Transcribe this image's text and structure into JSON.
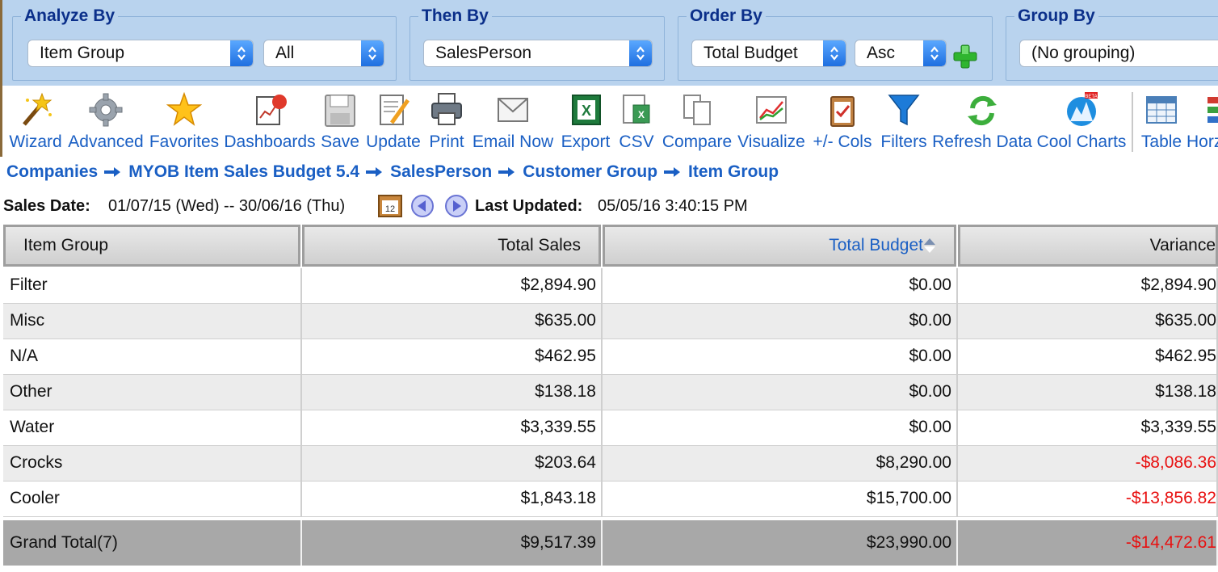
{
  "selectors": {
    "analyze_by": {
      "legend": "Analyze By",
      "field": "Item Group",
      "filter": "All"
    },
    "then_by": {
      "legend": "Then By",
      "field": "SalesPerson"
    },
    "order_by": {
      "legend": "Order By",
      "field": "Total Budget",
      "direction": "Asc"
    },
    "group_by": {
      "legend": "Group By",
      "field": "(No grouping)"
    }
  },
  "toolbar": [
    {
      "label": "Wizard",
      "icon": "wizard-wand-icon"
    },
    {
      "label": "Advanced",
      "icon": "gear-icon"
    },
    {
      "label": "Favorites",
      "icon": "star-icon"
    },
    {
      "label": "Dashboards",
      "icon": "dashboard-icon"
    },
    {
      "label": "Save",
      "icon": "floppy-disk-icon"
    },
    {
      "label": "Update",
      "icon": "edit-document-icon"
    },
    {
      "label": "Print",
      "icon": "printer-icon"
    },
    {
      "label": "Email Now",
      "icon": "email-icon"
    },
    {
      "label": "Export",
      "icon": "excel-icon"
    },
    {
      "label": "CSV",
      "icon": "csv-icon"
    },
    {
      "label": "Compare",
      "icon": "compare-icon"
    },
    {
      "label": "Visualize",
      "icon": "line-chart-icon"
    },
    {
      "label": "+/- Cols",
      "icon": "clipboard-check-icon"
    },
    {
      "label": "Filters",
      "icon": "funnel-icon"
    },
    {
      "label": "Refresh Data",
      "icon": "refresh-icon"
    },
    {
      "label": "Cool Charts",
      "icon": "cool-charts-icon",
      "badge": "BETA"
    },
    {
      "label": "Table",
      "icon": "table-icon"
    },
    {
      "label": "Horz",
      "icon": "horizontal-bars-icon"
    }
  ],
  "breadcrumb": [
    "Companies",
    "MYOB Item Sales Budget 5.4",
    "SalesPerson",
    "Customer Group",
    "Item Group"
  ],
  "dateline": {
    "sales_date_label": "Sales Date:",
    "sales_date_value": "01/07/15 (Wed) -- 30/06/16 (Thu)",
    "calendar_day": "12",
    "last_updated_label": "Last Updated:",
    "last_updated_value": "05/05/16 3:40:15 PM"
  },
  "table": {
    "columns": [
      "Item Group",
      "Total Sales",
      "Total Budget",
      "Variance"
    ],
    "sorted_column": "Total Budget",
    "rows": [
      {
        "group": "Filter",
        "sales": "$2,894.90",
        "budget": "$0.00",
        "variance": "$2,894.90",
        "negative": false
      },
      {
        "group": "Misc",
        "sales": "$635.00",
        "budget": "$0.00",
        "variance": "$635.00",
        "negative": false
      },
      {
        "group": "N/A",
        "sales": "$462.95",
        "budget": "$0.00",
        "variance": "$462.95",
        "negative": false
      },
      {
        "group": "Other",
        "sales": "$138.18",
        "budget": "$0.00",
        "variance": "$138.18",
        "negative": false
      },
      {
        "group": "Water",
        "sales": "$3,339.55",
        "budget": "$0.00",
        "variance": "$3,339.55",
        "negative": false
      },
      {
        "group": "Crocks",
        "sales": "$203.64",
        "budget": "$8,290.00",
        "variance": "-$8,086.36",
        "negative": true
      },
      {
        "group": "Cooler",
        "sales": "$1,843.18",
        "budget": "$15,700.00",
        "variance": "-$13,856.82",
        "negative": true
      }
    ],
    "total": {
      "label": "Grand Total(7)",
      "sales": "$9,517.39",
      "budget": "$23,990.00",
      "variance": "-$14,472.61",
      "negative": true
    }
  },
  "colors": {
    "band_bg": "#b9d3ee",
    "link_blue": "#1a5fc4",
    "legend_navy": "#0b2f8a",
    "negative_red": "#e81010"
  }
}
